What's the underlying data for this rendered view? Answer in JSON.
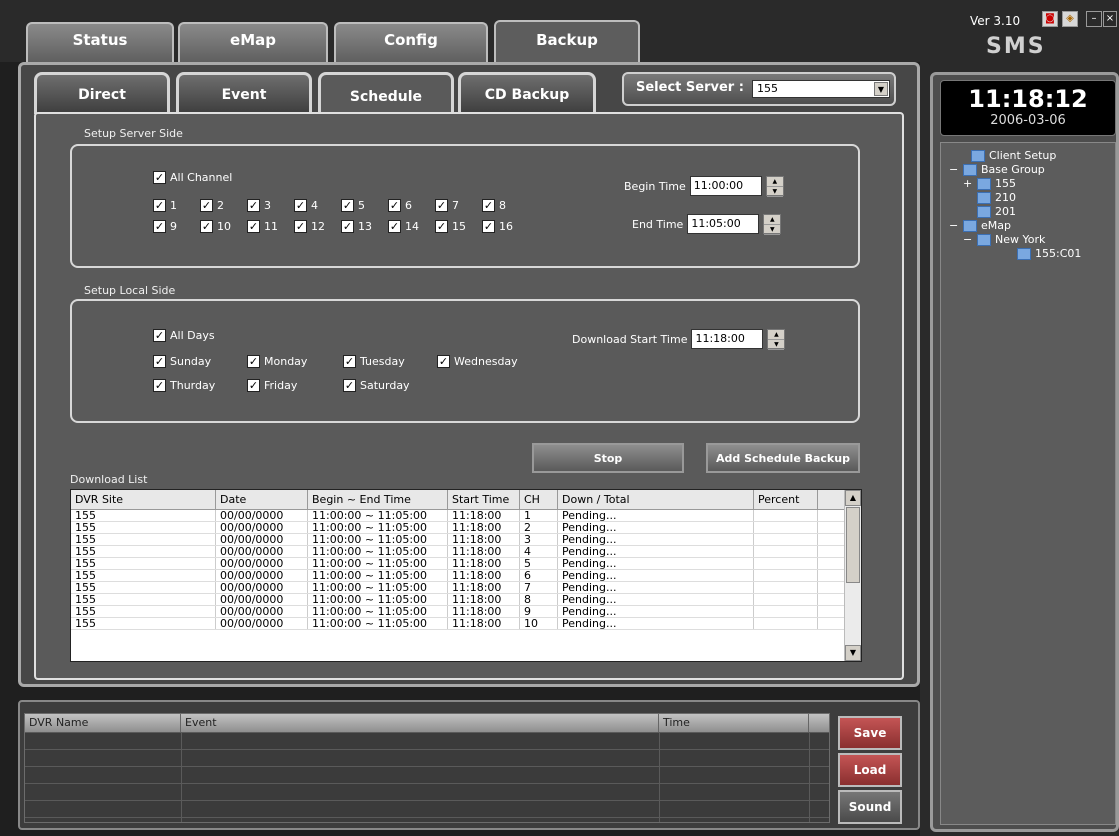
{
  "top_tabs": [
    "Status",
    "eMap",
    "Config",
    "Backup"
  ],
  "sub_tabs": [
    "Direct",
    "Event",
    "Schedule",
    "CD Backup"
  ],
  "select_server": {
    "label": "Select Server :",
    "value": "155"
  },
  "server_side": {
    "title": "Setup Server Side",
    "all_channel": "All Channel",
    "channels": [
      "1",
      "2",
      "3",
      "4",
      "5",
      "6",
      "7",
      "8",
      "9",
      "10",
      "11",
      "12",
      "13",
      "14",
      "15",
      "16"
    ],
    "begin_label": "Begin Time",
    "begin_value": "11:00:00",
    "end_label": "End Time",
    "end_value": "11:05:00"
  },
  "local_side": {
    "title": "Setup Local Side",
    "all_days": "All Days",
    "days": [
      "Sunday",
      "Monday",
      "Tuesday",
      "Wednesday",
      "Thurday",
      "Friday",
      "Saturday"
    ],
    "download_label": "Download Start Time",
    "download_value": "11:18:00"
  },
  "buttons": {
    "stop": "Stop",
    "add": "Add Schedule Backup"
  },
  "download_list": {
    "title": "Download List",
    "columns": [
      "DVR Site",
      "Date",
      "Begin ~ End Time",
      "Start Time",
      "CH",
      "Down / Total",
      "Percent"
    ],
    "rows": [
      [
        "155",
        "00/00/0000",
        "11:00:00 ~ 11:05:00",
        "11:18:00",
        "1",
        "Pending...",
        ""
      ],
      [
        "155",
        "00/00/0000",
        "11:00:00 ~ 11:05:00",
        "11:18:00",
        "2",
        "Pending...",
        ""
      ],
      [
        "155",
        "00/00/0000",
        "11:00:00 ~ 11:05:00",
        "11:18:00",
        "3",
        "Pending...",
        ""
      ],
      [
        "155",
        "00/00/0000",
        "11:00:00 ~ 11:05:00",
        "11:18:00",
        "4",
        "Pending...",
        ""
      ],
      [
        "155",
        "00/00/0000",
        "11:00:00 ~ 11:05:00",
        "11:18:00",
        "5",
        "Pending...",
        ""
      ],
      [
        "155",
        "00/00/0000",
        "11:00:00 ~ 11:05:00",
        "11:18:00",
        "6",
        "Pending...",
        ""
      ],
      [
        "155",
        "00/00/0000",
        "11:00:00 ~ 11:05:00",
        "11:18:00",
        "7",
        "Pending...",
        ""
      ],
      [
        "155",
        "00/00/0000",
        "11:00:00 ~ 11:05:00",
        "11:18:00",
        "8",
        "Pending...",
        ""
      ],
      [
        "155",
        "00/00/0000",
        "11:00:00 ~ 11:05:00",
        "11:18:00",
        "9",
        "Pending...",
        ""
      ],
      [
        "155",
        "00/00/0000",
        "11:00:00 ~ 11:05:00",
        "11:18:00",
        "10",
        "Pending...",
        ""
      ]
    ]
  },
  "event_log": {
    "columns": [
      "DVR Name",
      "Event",
      "Time"
    ]
  },
  "side_buttons": [
    "Save",
    "Load",
    "Sound"
  ],
  "right": {
    "version": "Ver 3.10",
    "app": "SMS",
    "time": "11:18:12",
    "date": "2006-03-06",
    "tree": [
      {
        "label": "Client Setup",
        "exp": ""
      },
      {
        "label": "Base Group",
        "exp": "−"
      },
      {
        "label": "155",
        "exp": "+"
      },
      {
        "label": "210",
        "exp": ""
      },
      {
        "label": "201",
        "exp": ""
      },
      {
        "label": "eMap",
        "exp": "−"
      },
      {
        "label": "New York",
        "exp": "−"
      },
      {
        "label": "155:C01",
        "exp": ""
      }
    ]
  },
  "colors": {
    "accent_red": "#a93a3a",
    "panel": "#5a5a5a"
  }
}
